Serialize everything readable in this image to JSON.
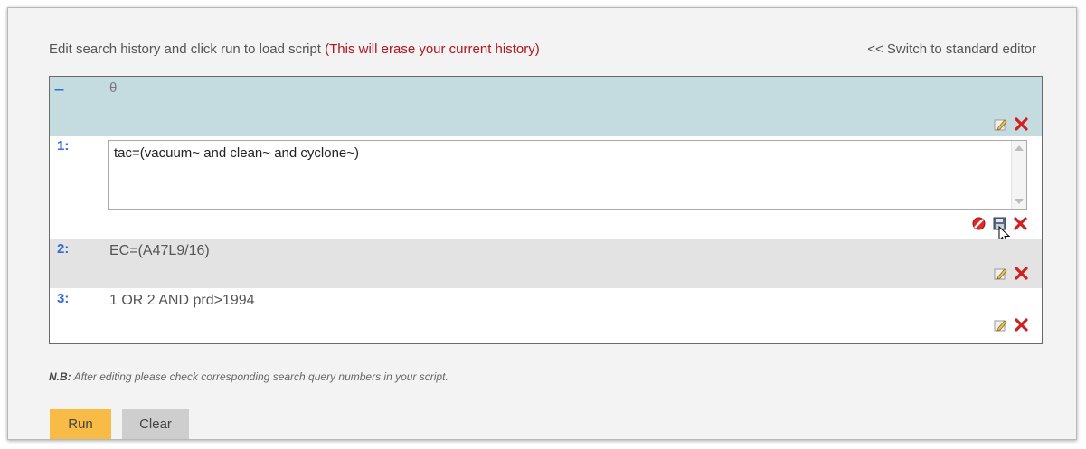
{
  "header": {
    "instruction": "Edit search history and click run to load script",
    "warning": "(This will erase your current history)",
    "switch_link": "<< Switch to standard editor"
  },
  "history": {
    "group_toggle": "–",
    "group_symbol": "θ",
    "rows": [
      {
        "number": "1:",
        "query": "tac=(vacuum~ and clean~ and cyclone~)",
        "editing": true
      },
      {
        "number": "2:",
        "query": "EC=(A47L9/16)",
        "editing": false
      },
      {
        "number": "3:",
        "query": "1 OR 2 AND prd>1994",
        "editing": false
      }
    ]
  },
  "note": {
    "label": "N.B:",
    "text": "After editing please check corresponding search query numbers in your script."
  },
  "buttons": {
    "run": "Run",
    "clear": "Clear"
  },
  "icons": {
    "edit": "pencil-edit-icon",
    "delete": "red-x-delete-icon",
    "cancel": "red-cancel-icon",
    "save": "floppy-save-icon"
  },
  "colors": {
    "accent": "#3a6bd0",
    "warning": "#b0151d",
    "run_button": "#f8bb46",
    "group_header": "#c4dcdf"
  }
}
